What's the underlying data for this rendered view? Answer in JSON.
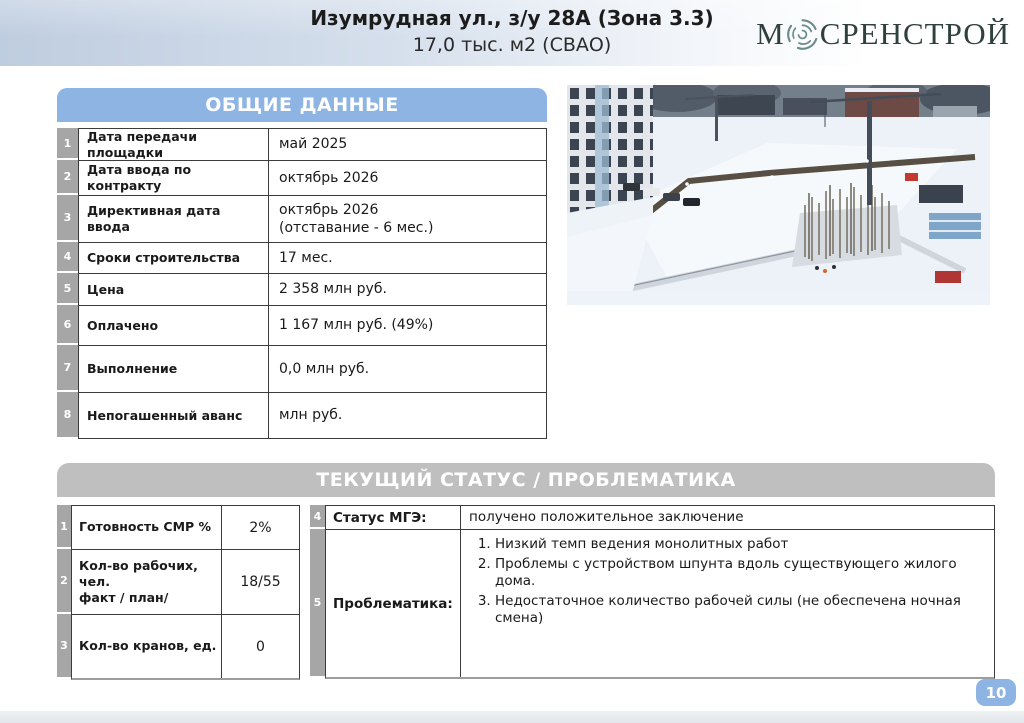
{
  "header": {
    "title": "Изумрудная ул., з/у 28А (Зона 3.3)",
    "subtitle": "17,0 тыс. м2 (СВАО)",
    "logo": {
      "prefix": "М",
      "text": "СРЕНСТРОЙ"
    }
  },
  "icons": {
    "logo_swirl": "vortex-circle-icon"
  },
  "general": {
    "title": "ОБЩИЕ ДАННЫЕ",
    "rows": [
      {
        "num": "1",
        "label": "Дата передачи площадки",
        "value": "май 2025"
      },
      {
        "num": "2",
        "label": "Дата ввода по контракту",
        "value": "октябрь 2026"
      },
      {
        "num": "3",
        "label": "Директивная дата ввода",
        "value": "октябрь 2026\n(отставание - 6 мес.)"
      },
      {
        "num": "4",
        "label": "Сроки строительства",
        "value": "17 мес."
      },
      {
        "num": "5",
        "label": "Цена",
        "value": "2 358 млн руб."
      },
      {
        "num": "6",
        "label": "Оплачено",
        "value": "1 167 млн руб. (49%)"
      },
      {
        "num": "7",
        "label": "Выполнение",
        "value": "0,0 млн руб."
      },
      {
        "num": "8",
        "label": "Непогашенный аванс",
        "value": "млн руб."
      }
    ]
  },
  "status": {
    "title": "ТЕКУЩИЙ СТАТУС / ПРОБЛЕМАТИКА",
    "left_rows": [
      {
        "num": "1",
        "label": "Готовность СМР %",
        "value": "2%"
      },
      {
        "num": "2",
        "label": "Кол-во рабочих, чел.\nфакт / план/",
        "value": "18/55"
      },
      {
        "num": "3",
        "label": "Кол-во кранов, ед.",
        "value": "0"
      }
    ],
    "mge": {
      "num": "4",
      "label": "Статус МГЭ:",
      "value": "получено положительное заключение"
    },
    "problems": {
      "num": "5",
      "label": "Проблематика:",
      "items": [
        "Низкий темп ведения монолитных работ",
        "Проблемы с устройством шпунта вдоль существующего жилого дома.",
        "Недостаточное количество рабочей силы (не обеспечена ночная смена)"
      ]
    }
  },
  "page_number": "10",
  "colors": {
    "accent_blue": "#8db4e2",
    "header_gray": "#bfbfbf",
    "num_col_gray": "#a6a6a6",
    "banner_blue": "#bfcde0"
  }
}
